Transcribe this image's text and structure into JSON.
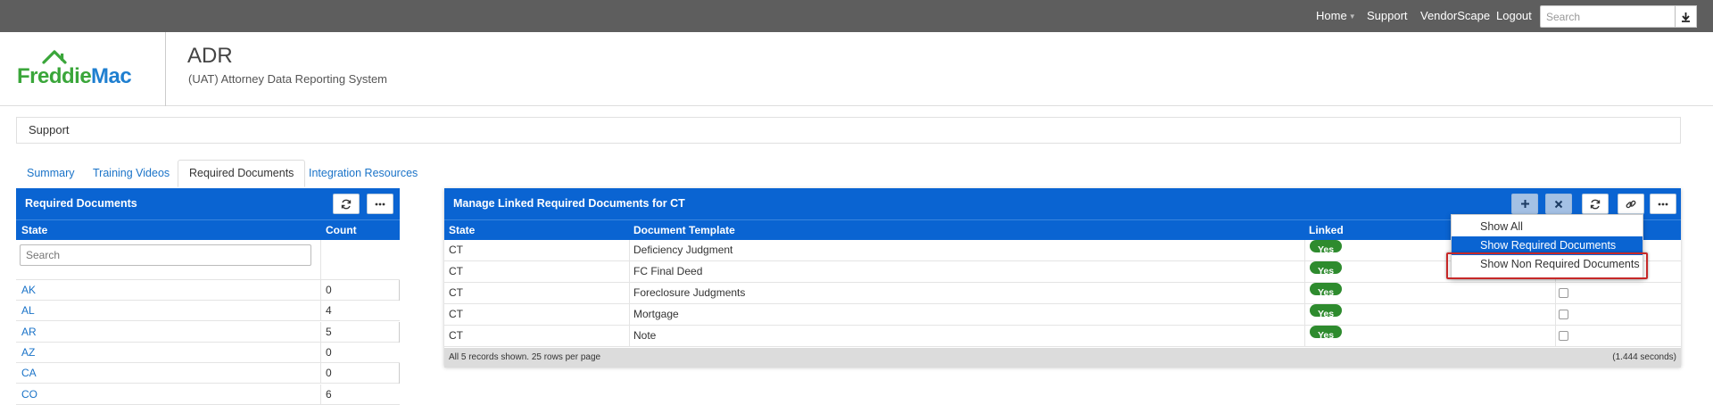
{
  "topnav": {
    "links": [
      "Home",
      "Support",
      "VendorScape",
      "Logout"
    ],
    "search_placeholder": "Search"
  },
  "header": {
    "logo_text": "FreddieMac",
    "title": "ADR",
    "subtitle": "(UAT) Attorney Data Reporting System"
  },
  "breadcrumb": "Support",
  "tabs": [
    "Summary",
    "Training Videos",
    "Required Documents",
    "Integration Resources"
  ],
  "left_panel": {
    "title": "Required Documents",
    "columns": [
      "State",
      "Count"
    ],
    "search_placeholder": "Search",
    "rows": [
      {
        "state": "AK",
        "count": "0"
      },
      {
        "state": "AL",
        "count": "4"
      },
      {
        "state": "AR",
        "count": "5"
      },
      {
        "state": "AZ",
        "count": "0"
      },
      {
        "state": "CA",
        "count": "0"
      },
      {
        "state": "CO",
        "count": "6"
      }
    ]
  },
  "right_panel": {
    "title": "Manage Linked Required Documents for CT",
    "columns": [
      "State",
      "Document Template",
      "Linked"
    ],
    "rows": [
      {
        "state": "CT",
        "template": "Deficiency Judgment",
        "linked": "Yes"
      },
      {
        "state": "CT",
        "template": "FC Final Deed",
        "linked": "Yes"
      },
      {
        "state": "CT",
        "template": "Foreclosure Judgments",
        "linked": "Yes"
      },
      {
        "state": "CT",
        "template": "Mortgage",
        "linked": "Yes"
      },
      {
        "state": "CT",
        "template": "Note",
        "linked": "Yes"
      }
    ],
    "footer_left": "All 5 records shown. 25 rows per page",
    "footer_right": "(1.444 seconds)"
  },
  "dropdown": {
    "items": [
      "Show All",
      "Show Required Documents",
      "Show Non Required Documents"
    ],
    "selected_index": 1,
    "highlighted_index": 2
  },
  "colors": {
    "nav_bg": "#5e5e5e",
    "panel_header": "#0a64d2",
    "link": "#1a73c8",
    "yes_badge": "#2e8b2e",
    "highlight_border": "#c62828",
    "logo_green": "#3aa63a",
    "logo_blue": "#1f7fd0"
  },
  "icons": [
    "download-icon",
    "refresh-icon",
    "more-icon",
    "plus-icon",
    "close-icon",
    "link-icon"
  ]
}
